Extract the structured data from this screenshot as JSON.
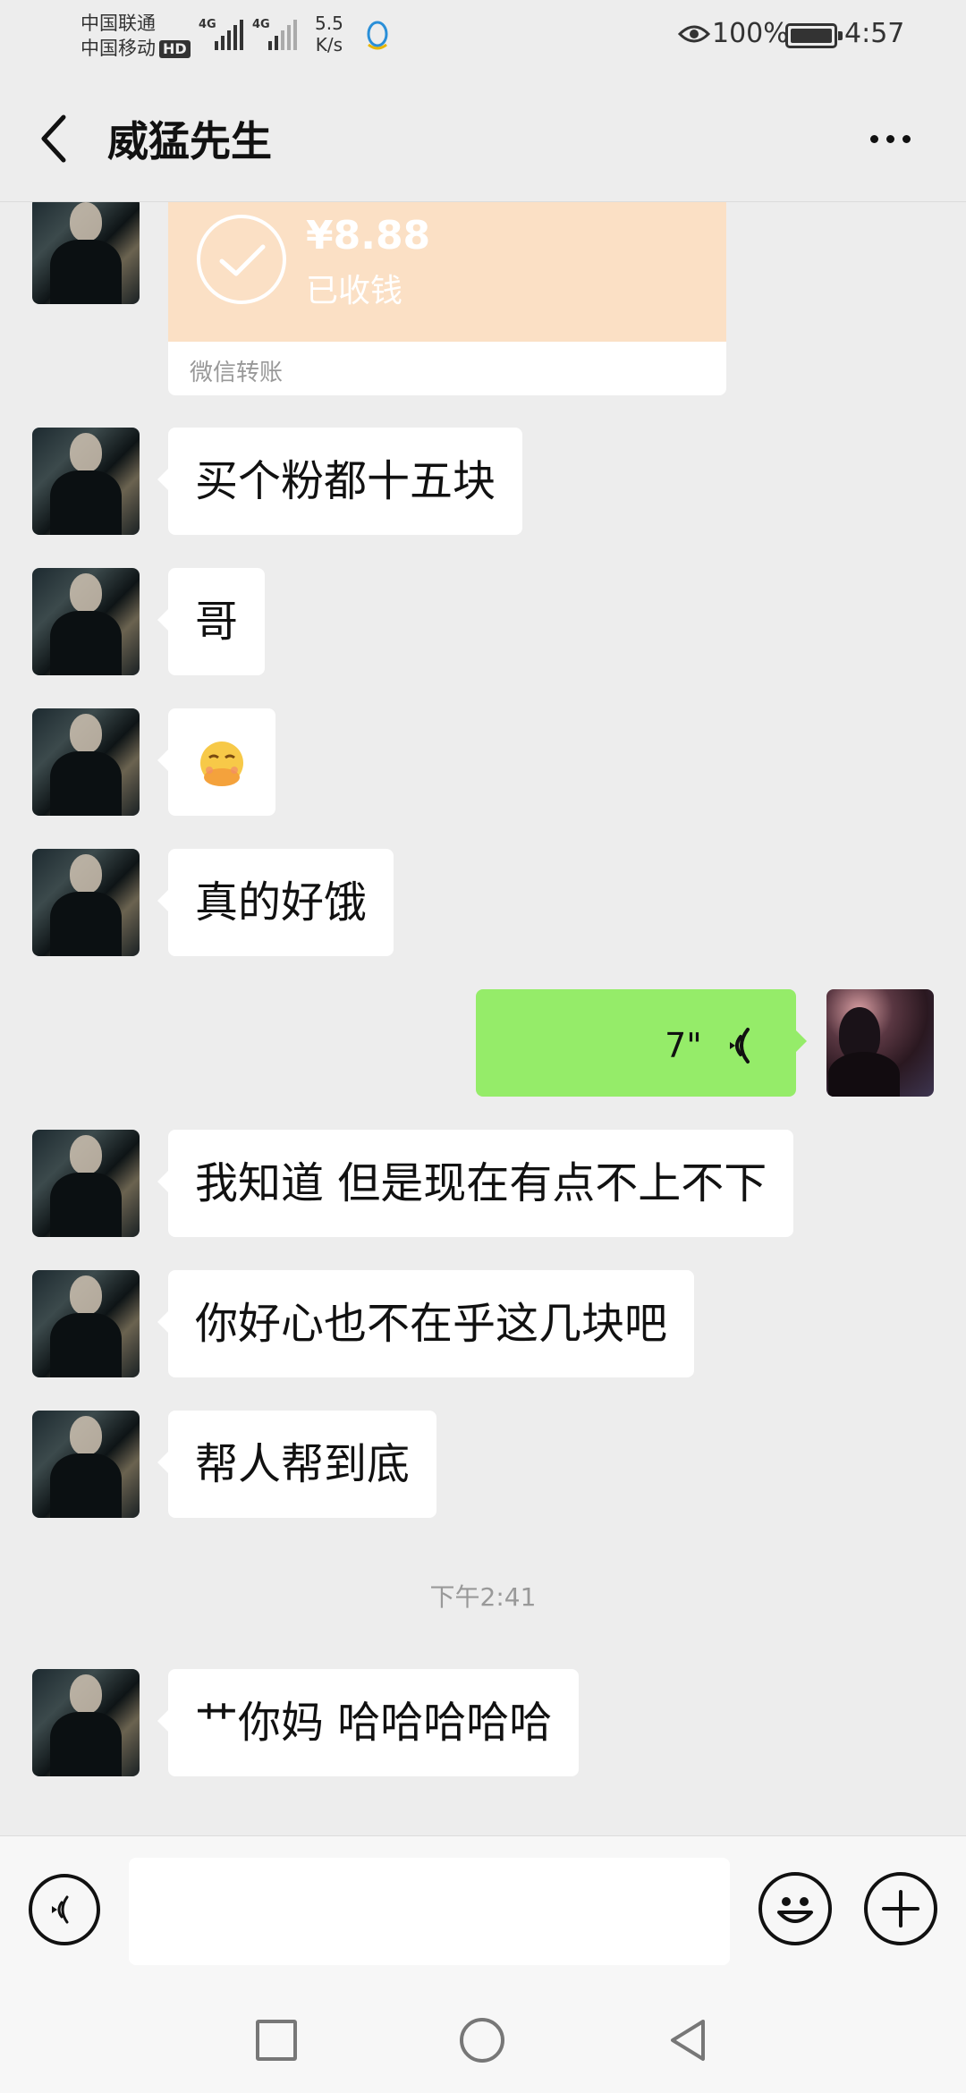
{
  "status_bar": {
    "carrier1": "中国联通",
    "carrier2": "中国移动",
    "hd_badge": "HD",
    "network1": "4G",
    "network2": "4G",
    "speed_value": "5.5",
    "speed_unit": "K/s",
    "battery": "100%",
    "time": "4:57"
  },
  "header": {
    "title": "威猛先生",
    "back_icon": "chevron-left-icon",
    "more_icon": "more-dots-icon"
  },
  "transfer": {
    "amount": "¥8.88",
    "status": "已收钱",
    "label": "微信转账"
  },
  "messages": [
    {
      "side": "left",
      "text": "买个粉都十五块"
    },
    {
      "side": "left",
      "text": "哥"
    },
    {
      "side": "left",
      "emoji": "face-with-hand-over-mouth"
    },
    {
      "side": "left",
      "text": "真的好饿"
    },
    {
      "side": "right",
      "voice_duration": "7\""
    },
    {
      "side": "left",
      "text": "我知道  但是现在有点不上不下"
    },
    {
      "side": "left",
      "text": "你好心也不在乎这几块吧"
    },
    {
      "side": "left",
      "text": "帮人帮到底"
    },
    {
      "side": "left",
      "text": "艹你妈  哈哈哈哈哈"
    }
  ],
  "timestamp": "下午2:41",
  "input_bar": {
    "voice_icon": "voice-toggle-icon",
    "emoji_icon": "emoji-icon",
    "plus_icon": "plus-icon",
    "input_value": ""
  },
  "accent_colors": {
    "self_bubble": "#95ec69",
    "transfer_card": "#fbe0c5",
    "background": "#ededed"
  }
}
